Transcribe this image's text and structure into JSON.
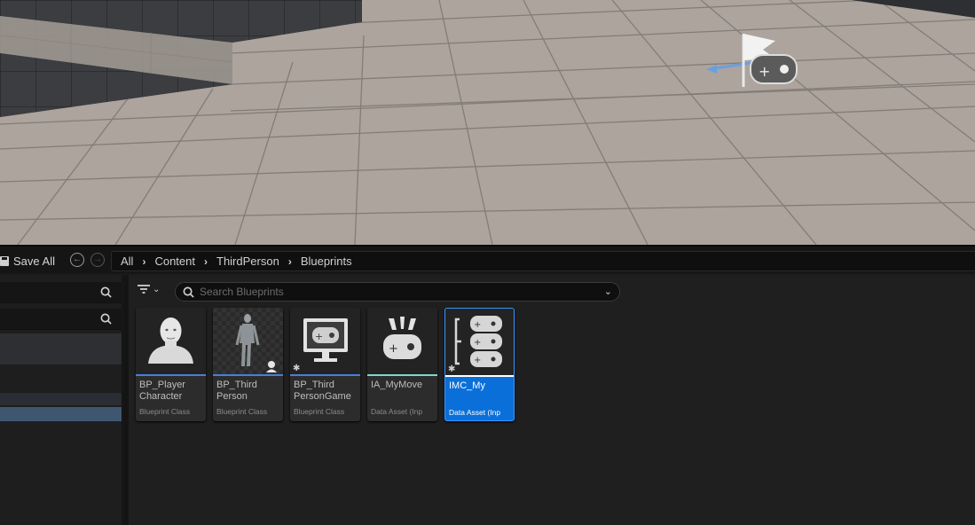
{
  "toolbar": {
    "save_all_label": "Save All",
    "back_icon": "arrow-left-circle-icon",
    "forward_icon": "arrow-right-circle-icon"
  },
  "breadcrumb": {
    "items": [
      "All",
      "Content",
      "ThirdPerson",
      "Blueprints"
    ]
  },
  "search": {
    "placeholder": "Search Blueprints"
  },
  "assets": [
    {
      "name": "BP_Player\nCharacter",
      "type": "Blueprint Class",
      "bar_color": "#4a7fd6",
      "icon": "person-bust-icon",
      "selected": false
    },
    {
      "name": "BP_Third\nPerson\nCharacter",
      "type": "Blueprint Class",
      "bar_color": "#4a7fd6",
      "icon": "mannequin-icon",
      "selected": false
    },
    {
      "name": "BP_Third\nPersonGame\nMode",
      "type": "Blueprint Class",
      "bar_color": "#4a7fd6",
      "icon": "monitor-gamepad-icon",
      "selected": false
    },
    {
      "name": "IA_MyMove",
      "type": "Data Asset (Inp",
      "bar_color": "#7fd6c9",
      "icon": "gamepad-action-icon",
      "selected": false
    },
    {
      "name": "IMC_My",
      "type": "Data Asset (Inp",
      "bar_color": "#ffffff",
      "icon": "gamepad-stack-icon",
      "selected": true
    }
  ],
  "colors": {
    "selection": "#0a6fd9",
    "panel_bg": "#1f1f1f",
    "floor": "#aaa19a"
  }
}
